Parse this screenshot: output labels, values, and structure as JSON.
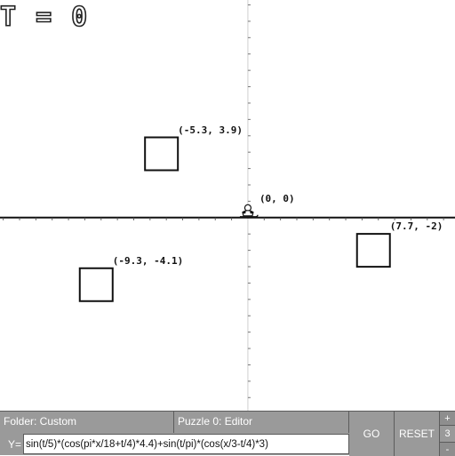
{
  "time_display": {
    "label": "T",
    "equals": "=",
    "value": "0"
  },
  "graph": {
    "x_range": [
      -15.2,
      12.7
    ],
    "y_range": [
      -11.8,
      13.3
    ],
    "targets": [
      {
        "label": "(-5.3, 3.9)",
        "x": -5.3,
        "y": 3.9
      },
      {
        "label": "(7.7, -2)",
        "x": 7.7,
        "y": -2
      },
      {
        "label": "(-9.3, -4.1)",
        "x": -9.3,
        "y": -4.1
      }
    ],
    "sledder": {
      "label": "(0, 0)",
      "x": 0,
      "y": 0
    }
  },
  "controls": {
    "folder_label": "Folder: Custom",
    "puzzle_label": "Puzzle 0: Editor",
    "y_prefix": "Y=",
    "equation": "sin(t/5)*(cos(pi*x/18+t/4)*4.4)+sin(t/pi)*(cos(x/3-t/4)*3)",
    "go_label": "GO",
    "reset_label": "RESET",
    "speed_plus": "+",
    "speed_value": "3",
    "speed_minus": "-"
  },
  "colors": {
    "axis": "#111111",
    "target_stroke": "#111111",
    "bar_background": "#9a9a9a",
    "bar_text": "#ffffff"
  }
}
